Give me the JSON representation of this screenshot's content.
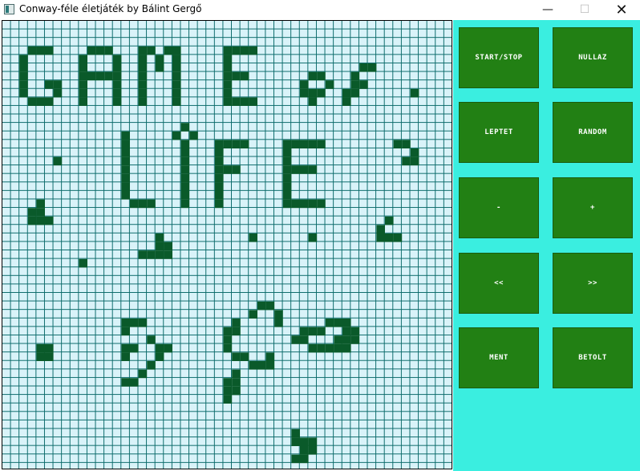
{
  "window": {
    "title": "Conway-féle életjáték by Bálint Gergő",
    "minimize_icon": "minimize-icon",
    "maximize_icon": "maximize-icon",
    "close_icon": "close-icon",
    "minimize_glyph": "—",
    "maximize_glyph": "☐",
    "close_glyph": "✕"
  },
  "colors": {
    "cell_alive": "#0a5a2a",
    "cell_dead": "#d9f3f9",
    "grid_line": "#0a6a6a",
    "panel_bg": "#3aeee0",
    "button_bg": "#228014",
    "button_text": "#ffffff"
  },
  "grid": {
    "cols": 53,
    "rows": 53,
    "live_cells": [
      [
        3,
        3
      ],
      [
        4,
        3
      ],
      [
        5,
        3
      ],
      [
        2,
        4
      ],
      [
        2,
        5
      ],
      [
        2,
        6
      ],
      [
        2,
        7
      ],
      [
        2,
        8
      ],
      [
        3,
        9
      ],
      [
        4,
        9
      ],
      [
        5,
        9
      ],
      [
        6,
        8
      ],
      [
        6,
        7
      ],
      [
        5,
        7
      ],
      [
        10,
        3
      ],
      [
        11,
        3
      ],
      [
        12,
        3
      ],
      [
        9,
        4
      ],
      [
        9,
        5
      ],
      [
        9,
        6
      ],
      [
        9,
        7
      ],
      [
        9,
        8
      ],
      [
        9,
        9
      ],
      [
        13,
        4
      ],
      [
        13,
        5
      ],
      [
        13,
        6
      ],
      [
        13,
        7
      ],
      [
        13,
        8
      ],
      [
        13,
        9
      ],
      [
        10,
        6
      ],
      [
        11,
        6
      ],
      [
        12,
        6
      ],
      [
        16,
        3
      ],
      [
        17,
        3
      ],
      [
        16,
        4
      ],
      [
        16,
        5
      ],
      [
        16,
        6
      ],
      [
        16,
        7
      ],
      [
        16,
        8
      ],
      [
        16,
        9
      ],
      [
        18,
        4
      ],
      [
        18,
        5
      ],
      [
        19,
        3
      ],
      [
        20,
        3
      ],
      [
        20,
        4
      ],
      [
        20,
        5
      ],
      [
        20,
        6
      ],
      [
        20,
        7
      ],
      [
        20,
        8
      ],
      [
        20,
        9
      ],
      [
        26,
        3
      ],
      [
        27,
        3
      ],
      [
        28,
        3
      ],
      [
        29,
        3
      ],
      [
        26,
        4
      ],
      [
        26,
        5
      ],
      [
        26,
        6
      ],
      [
        26,
        7
      ],
      [
        26,
        8
      ],
      [
        26,
        9
      ],
      [
        27,
        6
      ],
      [
        28,
        6
      ],
      [
        27,
        9
      ],
      [
        28,
        9
      ],
      [
        29,
        9
      ],
      [
        35,
        7
      ],
      [
        36,
        6
      ],
      [
        37,
        6
      ],
      [
        38,
        7
      ],
      [
        37,
        8
      ],
      [
        36,
        9
      ],
      [
        35,
        8
      ],
      [
        36,
        8
      ],
      [
        41,
        6
      ],
      [
        42,
        5
      ],
      [
        43,
        5
      ],
      [
        41,
        7
      ],
      [
        42,
        7
      ],
      [
        41,
        8
      ],
      [
        40,
        8
      ],
      [
        40,
        9
      ],
      [
        48,
        8
      ],
      [
        14,
        13
      ],
      [
        14,
        14
      ],
      [
        14,
        15
      ],
      [
        14,
        16
      ],
      [
        14,
        17
      ],
      [
        14,
        18
      ],
      [
        14,
        19
      ],
      [
        15,
        21
      ],
      [
        16,
        21
      ],
      [
        17,
        21
      ],
      [
        14,
        20
      ],
      [
        21,
        12
      ],
      [
        21,
        14
      ],
      [
        21,
        15
      ],
      [
        21,
        16
      ],
      [
        21,
        17
      ],
      [
        21,
        18
      ],
      [
        21,
        19
      ],
      [
        21,
        20
      ],
      [
        22,
        13
      ],
      [
        20,
        13
      ],
      [
        21,
        21
      ],
      [
        25,
        14
      ],
      [
        26,
        14
      ],
      [
        27,
        14
      ],
      [
        28,
        14
      ],
      [
        25,
        15
      ],
      [
        25,
        16
      ],
      [
        25,
        17
      ],
      [
        25,
        18
      ],
      [
        25,
        19
      ],
      [
        25,
        20
      ],
      [
        25,
        21
      ],
      [
        26,
        17
      ],
      [
        27,
        17
      ],
      [
        33,
        14
      ],
      [
        34,
        14
      ],
      [
        35,
        14
      ],
      [
        36,
        14
      ],
      [
        37,
        14
      ],
      [
        33,
        15
      ],
      [
        33,
        16
      ],
      [
        33,
        17
      ],
      [
        33,
        18
      ],
      [
        33,
        19
      ],
      [
        33,
        20
      ],
      [
        33,
        21
      ],
      [
        34,
        17
      ],
      [
        35,
        17
      ],
      [
        36,
        17
      ],
      [
        34,
        21
      ],
      [
        35,
        21
      ],
      [
        36,
        21
      ],
      [
        37,
        21
      ],
      [
        46,
        14
      ],
      [
        47,
        14
      ],
      [
        48,
        15
      ],
      [
        48,
        16
      ],
      [
        47,
        16
      ],
      [
        6,
        16
      ],
      [
        4,
        21
      ],
      [
        3,
        22
      ],
      [
        4,
        22
      ],
      [
        5,
        23
      ],
      [
        4,
        23
      ],
      [
        3,
        23
      ],
      [
        18,
        25
      ],
      [
        18,
        26
      ],
      [
        19,
        26
      ],
      [
        16,
        27
      ],
      [
        17,
        27
      ],
      [
        18,
        27
      ],
      [
        19,
        27
      ],
      [
        9,
        28
      ],
      [
        29,
        25
      ],
      [
        36,
        25
      ],
      [
        45,
        23
      ],
      [
        44,
        24
      ],
      [
        44,
        25
      ],
      [
        45,
        25
      ],
      [
        46,
        25
      ],
      [
        30,
        33
      ],
      [
        31,
        33
      ],
      [
        29,
        34
      ],
      [
        32,
        34
      ],
      [
        32,
        35
      ],
      [
        27,
        35
      ],
      [
        26,
        36
      ],
      [
        27,
        36
      ],
      [
        26,
        37
      ],
      [
        26,
        38
      ],
      [
        27,
        39
      ],
      [
        28,
        39
      ],
      [
        29,
        40
      ],
      [
        30,
        40
      ],
      [
        31,
        39
      ],
      [
        31,
        40
      ],
      [
        14,
        35
      ],
      [
        14,
        36
      ],
      [
        15,
        35
      ],
      [
        16,
        35
      ],
      [
        17,
        37
      ],
      [
        18,
        38
      ],
      [
        19,
        38
      ],
      [
        18,
        39
      ],
      [
        17,
        40
      ],
      [
        16,
        41
      ],
      [
        15,
        42
      ],
      [
        14,
        42
      ],
      [
        14,
        39
      ],
      [
        14,
        38
      ],
      [
        15,
        38
      ],
      [
        35,
        36
      ],
      [
        36,
        36
      ],
      [
        37,
        36
      ],
      [
        38,
        35
      ],
      [
        39,
        35
      ],
      [
        40,
        35
      ],
      [
        40,
        36
      ],
      [
        40,
        37
      ],
      [
        41,
        36
      ],
      [
        41,
        37
      ],
      [
        39,
        37
      ],
      [
        38,
        38
      ],
      [
        37,
        38
      ],
      [
        36,
        38
      ],
      [
        35,
        37
      ],
      [
        34,
        37
      ],
      [
        39,
        38
      ],
      [
        40,
        38
      ],
      [
        4,
        38
      ],
      [
        5,
        38
      ],
      [
        4,
        39
      ],
      [
        5,
        39
      ],
      [
        27,
        41
      ],
      [
        26,
        42
      ],
      [
        27,
        42
      ],
      [
        27,
        43
      ],
      [
        26,
        43
      ],
      [
        26,
        44
      ],
      [
        34,
        48
      ],
      [
        34,
        49
      ],
      [
        35,
        50
      ],
      [
        36,
        50
      ],
      [
        36,
        49
      ],
      [
        35,
        49
      ],
      [
        34,
        51
      ],
      [
        35,
        51
      ]
    ]
  },
  "controls": {
    "start_stop": "START/STOP",
    "nullaz": "NULLAZ",
    "leptet": "LEPTET",
    "random": "RANDOM",
    "minus": "-",
    "plus": "+",
    "back": "<<",
    "forward": ">>",
    "ment": "MENT",
    "betolt": "BETOLT"
  }
}
